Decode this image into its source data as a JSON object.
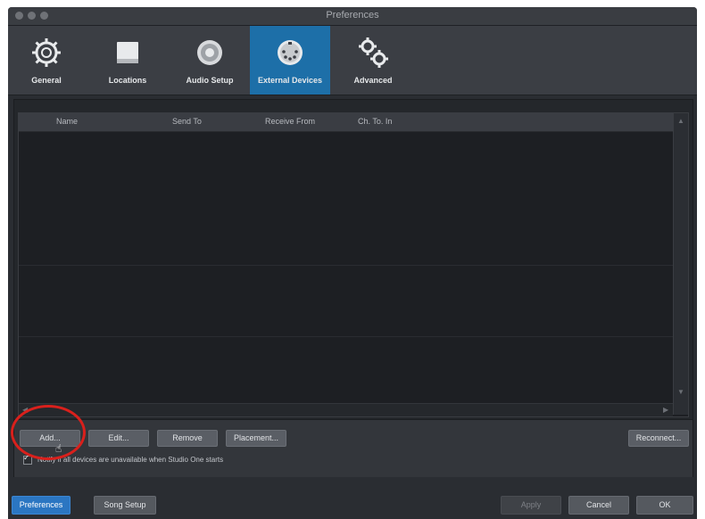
{
  "window": {
    "title": "Preferences"
  },
  "tabs": [
    {
      "label": "General",
      "icon": "gear-outline-icon"
    },
    {
      "label": "Locations",
      "icon": "folder-icon"
    },
    {
      "label": "Audio Setup",
      "icon": "speaker-icon"
    },
    {
      "label": "External Devices",
      "icon": "midi-port-icon",
      "active": true
    },
    {
      "label": "Advanced",
      "icon": "gears-icon"
    }
  ],
  "table": {
    "columns": [
      "Name",
      "Send To",
      "Receive From",
      "Ch. To. In"
    ]
  },
  "buttons": {
    "add": "Add...",
    "edit": "Edit...",
    "remove": "Remove",
    "placement": "Placement...",
    "reconnect": "Reconnect..."
  },
  "notify": {
    "checked": true,
    "text": "Notify if all devices are unavailable when Studio One starts"
  },
  "footer": {
    "preferences": "Preferences",
    "song_setup": "Song Setup",
    "apply": "Apply",
    "cancel": "Cancel",
    "ok": "OK"
  },
  "colors": {
    "accent": "#1d6fa8",
    "highlight": "#d9201c"
  }
}
